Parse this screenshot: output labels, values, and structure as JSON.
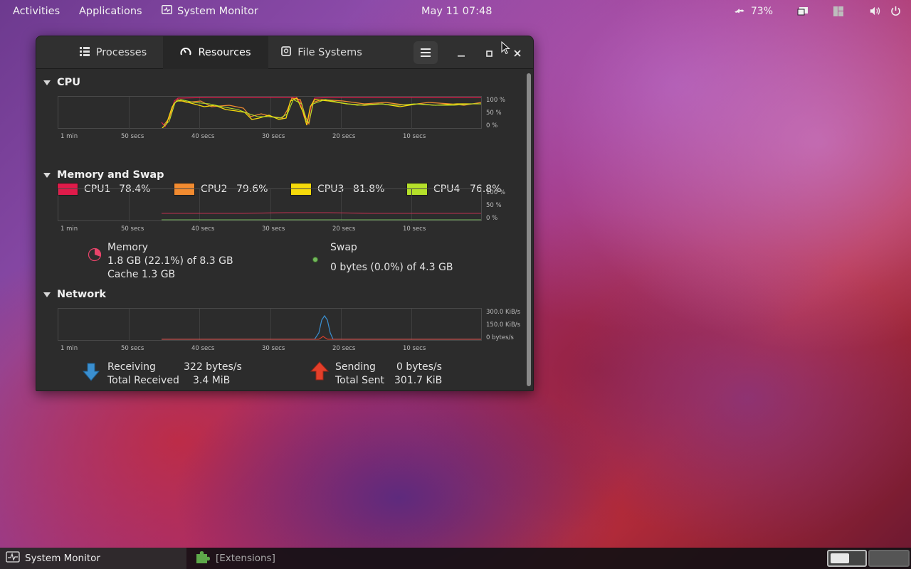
{
  "topbar": {
    "activities": "Activities",
    "applications": "Applications",
    "app_name": "System Monitor",
    "clock": "May 11  07:48",
    "battery_pct": "73%",
    "icons": [
      "weather-icon",
      "monitor-icon",
      "windows-icon",
      "volume-icon",
      "power-icon"
    ]
  },
  "window": {
    "tabs": [
      {
        "label": "Processes",
        "icon": "list-icon",
        "active": false
      },
      {
        "label": "Resources",
        "icon": "gauge-icon",
        "active": true
      },
      {
        "label": "File Systems",
        "icon": "disk-icon",
        "active": false
      }
    ]
  },
  "cpu": {
    "title": "CPU",
    "x_ticks": [
      "1 min",
      "50 secs",
      "40 secs",
      "30 secs",
      "20 secs",
      "10 secs"
    ],
    "y_ticks": [
      "100 %",
      "50 %",
      "0 %"
    ],
    "legend": [
      {
        "name": "CPU1",
        "value": "78.4%",
        "color": "#e01b4a"
      },
      {
        "name": "CPU2",
        "value": "79.6%",
        "color": "#f28b30"
      },
      {
        "name": "CPU3",
        "value": "81.8%",
        "color": "#f5d90a"
      },
      {
        "name": "CPU4",
        "value": "76.8%",
        "color": "#b5e02a"
      }
    ]
  },
  "memory": {
    "title": "Memory and Swap",
    "x_ticks": [
      "1 min",
      "50 secs",
      "40 secs",
      "30 secs",
      "20 secs",
      "10 secs"
    ],
    "y_ticks": [
      "100 %",
      "50 %",
      "0 %"
    ],
    "memory_label": "Memory",
    "memory_usage": "1.8 GB (22.1%) of 8.3 GB",
    "cache": "Cache 1.3 GB",
    "memory_color": "#e8446a",
    "swap_label": "Swap",
    "swap_usage": "0 bytes (0.0%) of 4.3 GB",
    "swap_color": "#73b85c"
  },
  "network": {
    "title": "Network",
    "x_ticks": [
      "1 min",
      "50 secs",
      "40 secs",
      "30 secs",
      "20 secs",
      "10 secs"
    ],
    "y_ticks": [
      "300.0 KiB/s",
      "150.0 KiB/s",
      "0 bytes/s"
    ],
    "receiving_label": "Receiving",
    "receiving_value": "322 bytes/s",
    "total_received_label": "Total Received",
    "total_received_value": "3.4 MiB",
    "sending_label": "Sending",
    "sending_value": "0 bytes/s",
    "total_sent_label": "Total Sent",
    "total_sent_value": "301.7 KiB",
    "receiving_color": "#3a8fd0",
    "sending_color": "#e33f2a"
  },
  "taskbar": {
    "active_task": "System Monitor",
    "other_task": "[Extensions]"
  }
}
